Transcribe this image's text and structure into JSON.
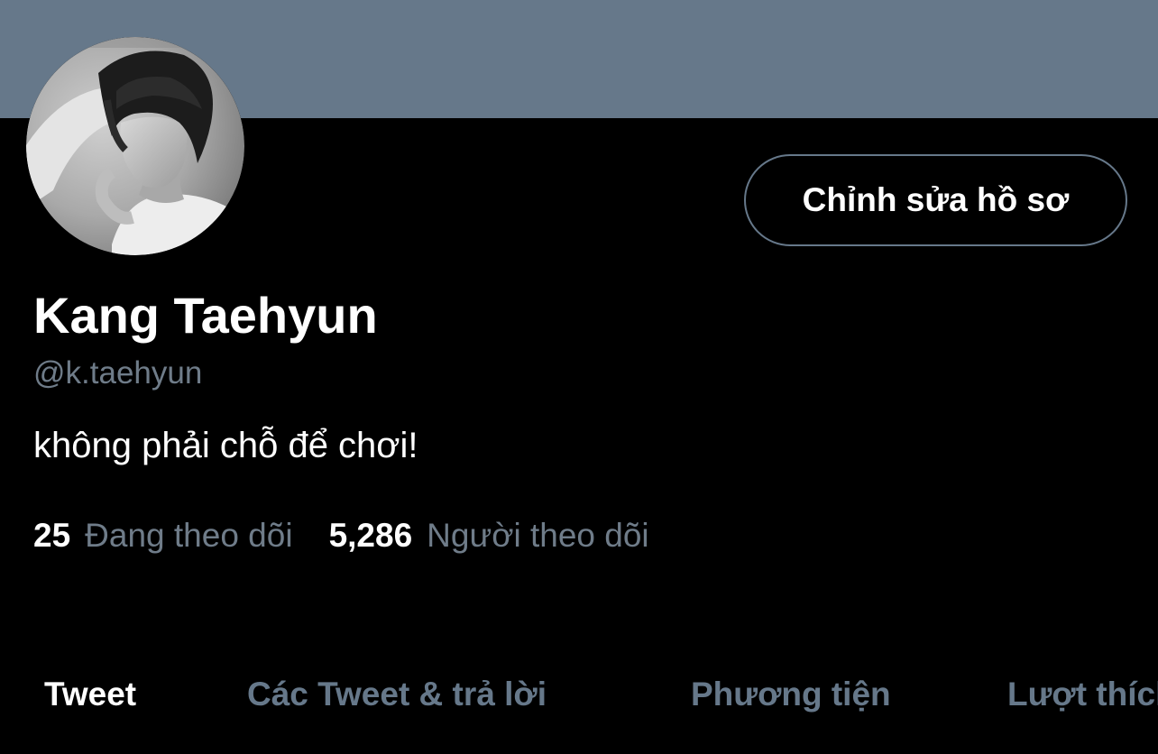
{
  "profile": {
    "display_name": "Kang Taehyun",
    "handle": "@k.taehyun",
    "bio": "không phải chỗ để chơi!",
    "edit_button_label": "Chỉnh sửa hồ sơ"
  },
  "stats": {
    "following_count": "25",
    "following_label": "Đang theo dõi",
    "followers_count": "5,286",
    "followers_label": "Người theo dõi"
  },
  "tabs": [
    {
      "label": "Tweet",
      "active": true
    },
    {
      "label": "Các Tweet & trả lời",
      "active": false
    },
    {
      "label": "Phương tiện",
      "active": false
    },
    {
      "label": "Lượt thích",
      "active": false
    }
  ],
  "colors": {
    "background": "#000000",
    "banner": "#66788a",
    "primary_text": "#ffffff",
    "secondary_text": "#6f7c89"
  }
}
